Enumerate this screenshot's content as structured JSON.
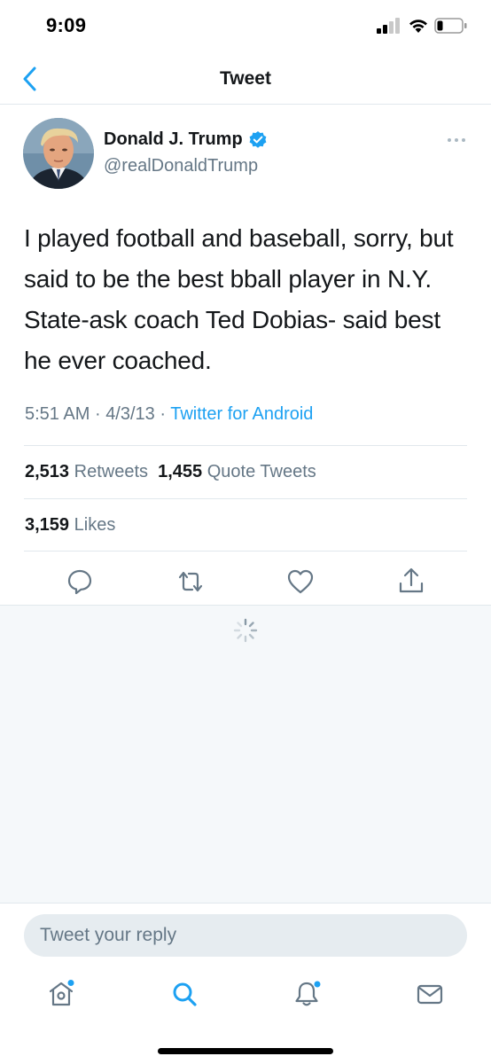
{
  "status_bar": {
    "time": "9:09"
  },
  "nav": {
    "title": "Tweet",
    "back_icon": "chevron-left-icon"
  },
  "tweet": {
    "author_name": "Donald J. Trump",
    "author_handle": "@realDonaldTrump",
    "verified": true,
    "text": "I played football and baseball, sorry, but said to be the best bball player in N.Y. State-ask coach Ted Dobias- said best he ever coached.",
    "time": "5:51 AM",
    "date": "4/3/13",
    "separator": "·",
    "source": "Twitter for Android",
    "retweets_count": "2,513",
    "retweets_label": "Retweets",
    "quotes_count": "1,455",
    "quotes_label": "Quote Tweets",
    "likes_count": "3,159",
    "likes_label": "Likes"
  },
  "reply": {
    "placeholder": "Tweet your reply"
  },
  "tab_bar": {
    "items": [
      "home-icon",
      "search-icon",
      "notifications-icon",
      "messages-icon"
    ]
  },
  "colors": {
    "accent": "#1da1f2",
    "secondary_text": "#657786",
    "primary_text": "#14171a",
    "divider": "#e1e8ed",
    "background_gray": "#f5f8fa"
  }
}
